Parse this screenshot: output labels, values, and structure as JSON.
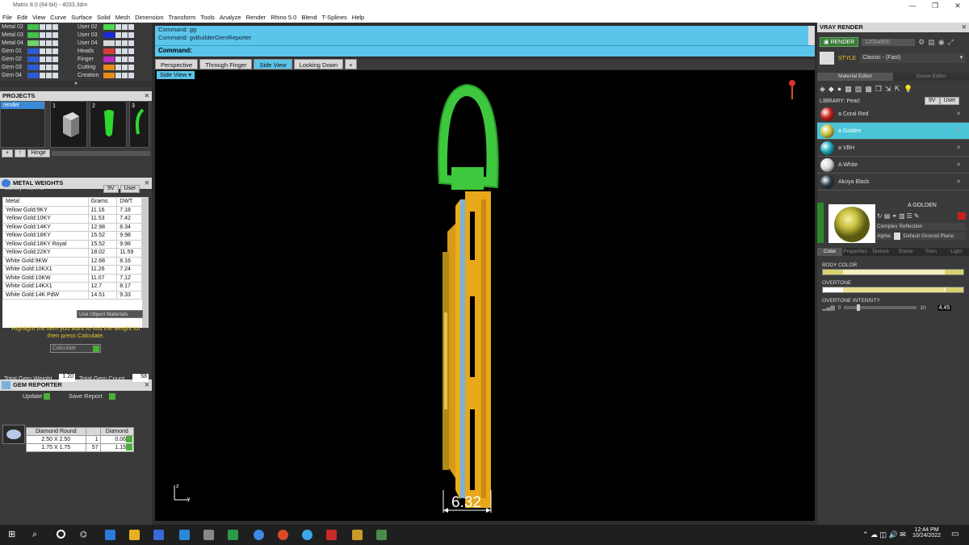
{
  "window": {
    "title": "Matrix 8.0 (64-bit) - 4033.3dm",
    "min": "—",
    "max": "❐",
    "close": "✕"
  },
  "menu": [
    "File",
    "Edit",
    "View",
    "Curve",
    "Surface",
    "Solid",
    "Mesh",
    "Dimension",
    "Transform",
    "Tools",
    "Analyze",
    "Render",
    "Rhino 5.0",
    "Blend",
    "T-Splines",
    "Help"
  ],
  "layers": {
    "left": [
      {
        "name": "Metal 02",
        "color": "#44c24a"
      },
      {
        "name": "Metal 03",
        "color": "#44c24a"
      },
      {
        "name": "Metal 04",
        "color": "#6fd36a"
      },
      {
        "name": "Gem 01",
        "color": "#2e5ad8"
      },
      {
        "name": "Gem 02",
        "color": "#2e5ad8"
      },
      {
        "name": "Gem 03",
        "color": "#2e5ad8"
      },
      {
        "name": "Gem 04",
        "color": "#2e5ad8"
      }
    ],
    "right": [
      {
        "name": "User 02",
        "color": "#4cd84a"
      },
      {
        "name": "User 03",
        "color": "#1a2ad8"
      },
      {
        "name": "User 04",
        "color": "#d8d8d8"
      },
      {
        "name": "Heads",
        "color": "#d83a3a"
      },
      {
        "name": "Finger",
        "color": "#c02ac0"
      },
      {
        "name": "Cutting",
        "color": "#e88a1a"
      },
      {
        "name": "Creation",
        "color": "#e88a1a"
      }
    ]
  },
  "projects": {
    "title": "PROJECTS",
    "item": "render",
    "thumbs": [
      "1",
      "2",
      "3"
    ],
    "hinge_label": "Hinge"
  },
  "metal_weights": {
    "title": "METAL WEIGHTS",
    "library_label": "Library: METAL",
    "lib_9v": "9V",
    "lib_user": "User",
    "headers": [
      "Metal",
      "Grams",
      "DWT"
    ],
    "rows": [
      [
        "Yellow Gold:9KY",
        "11.16",
        "7.18"
      ],
      [
        "Yellow Gold:10KY",
        "11.53",
        "7.42"
      ],
      [
        "Yellow Gold:14KY",
        "12.98",
        "8.34"
      ],
      [
        "Yellow Gold:18KY",
        "15.52",
        "9.98"
      ],
      [
        "Yellow Gold:18KY Royal",
        "15.52",
        "9.98"
      ],
      [
        "Yellow Gold:22KY",
        "18.02",
        "11.59"
      ],
      [
        "White Gold:9KW",
        "12.68",
        "8.16"
      ],
      [
        "White Gold:10KX1",
        "11.26",
        "7.24"
      ],
      [
        "White Gold:10KW",
        "11.07",
        "7.12"
      ],
      [
        "White Gold:14KX1",
        "12.7",
        "8.17"
      ],
      [
        "White Gold:14K PdW",
        "14.51",
        "9.33"
      ]
    ],
    "use_object_materials": "Use Object Materials",
    "hint": "Highlight the item you want to find the weight for then press Calculate.",
    "calculate": "Calculate"
  },
  "gem_reporter": {
    "title": "GEM REPORTER",
    "total_weight_label": "Total Gem Weight",
    "total_weight": "1.20",
    "total_count_label": "Total Gem Count",
    "total_count": "58",
    "update": "Update",
    "save_report": "Save Report",
    "headers": [
      "Diamond Round",
      "",
      "Diamond"
    ],
    "rows": [
      [
        "2.50 X 2.50",
        "1",
        "0.06tw"
      ],
      [
        "1.75 X 1.75",
        "57",
        "1.15tw"
      ]
    ]
  },
  "command": {
    "line1": "Command: gg",
    "line2": "Command: gvBuilderGemReporter",
    "prompt": "Command:"
  },
  "tabs": [
    "Perspective",
    "Through Finger",
    "Side View",
    "Looking Down",
    "+"
  ],
  "active_tab": "Side View",
  "viewport": {
    "label": "Side View",
    "dimension": "6.32",
    "axis_z": "z",
    "axis_y": "y"
  },
  "vray": {
    "title": "VRAY RENDER",
    "render_btn": "RENDER",
    "resolution": "1200x900",
    "style_label": "STYLE",
    "style_value": "Classic - (Fast)",
    "tab_material": "Material Editor",
    "tab_scene": "Scene Editor",
    "library_label": "LIBRARY: Pearl",
    "lib_9v": "9V",
    "lib_user": "User",
    "materials": [
      {
        "name": "a Coral Red",
        "color": "#c8201a"
      },
      {
        "name": "a Golden",
        "color": "#c9c03a"
      },
      {
        "name": "a VBH",
        "color": "#20a8b8"
      },
      {
        "name": "A White",
        "color": "#d8d8d8"
      },
      {
        "name": "Akoya Black",
        "color": "#2a3848"
      }
    ],
    "selected_material": "A GOLDEN",
    "reflection": "Complex Reflection",
    "alpha": "Alpha",
    "ground": "Default Ground Plane",
    "subtabs": [
      "Color",
      "Properties",
      "Texture",
      "Scene",
      "Toon",
      "Light"
    ],
    "body_color": "BODY COLOR",
    "overtone": "OVERTONE",
    "overtone_intensity": "OVERTONE INTENSITY",
    "oi_min": "0",
    "oi_max": "10",
    "oi_value": "4.45"
  },
  "taskbar": {
    "time": "12:44 PM",
    "date": "10/24/2022"
  }
}
